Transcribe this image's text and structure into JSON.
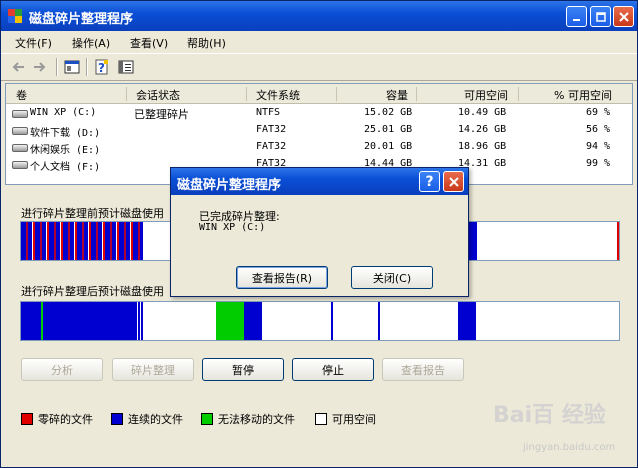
{
  "window": {
    "title": "磁盘碎片整理程序"
  },
  "menu": [
    {
      "label": "文件(F)"
    },
    {
      "label": "操作(A)"
    },
    {
      "label": "查看(V)"
    },
    {
      "label": "帮助(H)"
    }
  ],
  "toolbar_icons": [
    "back-arrow-icon",
    "forward-arrow-icon",
    "properties-icon",
    "help-icon",
    "view-icon"
  ],
  "volumes": {
    "columns": [
      "卷",
      "会话状态",
      "文件系统",
      "容量",
      "可用空间",
      "% 可用空间"
    ],
    "rows": [
      {
        "vol": "WIN XP (C:)",
        "status": "已整理碎片",
        "fs": "NTFS",
        "cap": "15.02 GB",
        "free": "10.49 GB",
        "pct": "69 %"
      },
      {
        "vol": "软件下载 (D:)",
        "status": "",
        "fs": "FAT32",
        "cap": "25.01 GB",
        "free": "14.26 GB",
        "pct": "56 %"
      },
      {
        "vol": "休闲娱乐 (E:)",
        "status": "",
        "fs": "FAT32",
        "cap": "20.01 GB",
        "free": "18.96 GB",
        "pct": "94 %"
      },
      {
        "vol": "个人文档 (F:)",
        "status": "",
        "fs": "FAT32",
        "cap": "14.44 GB",
        "free": "14.31 GB",
        "pct": "99 %"
      }
    ]
  },
  "labels": {
    "before": "进行碎片整理前预计磁盘使用",
    "after": "进行碎片整理后预计磁盘使用"
  },
  "buttons": {
    "analyze": "分析",
    "defrag": "碎片整理",
    "pause": "暂停",
    "stop": "停止",
    "report": "查看报告"
  },
  "legend": [
    {
      "label": "零碎的文件",
      "color": "#e00000"
    },
    {
      "label": "连续的文件",
      "color": "#0000d0"
    },
    {
      "label": "无法移动的文件",
      "color": "#00cc00"
    },
    {
      "label": "可用空间",
      "color": "#ffffff"
    }
  ],
  "dialog": {
    "title": "磁盘碎片整理程序",
    "message": "已完成碎片整理:",
    "volume": "WIN XP (C:)",
    "report_btn": "查看报告(R)",
    "close_btn": "关闭(C)"
  },
  "watermark": {
    "brand": "Bai百 经验",
    "url": "jingyan.baidu.com"
  }
}
